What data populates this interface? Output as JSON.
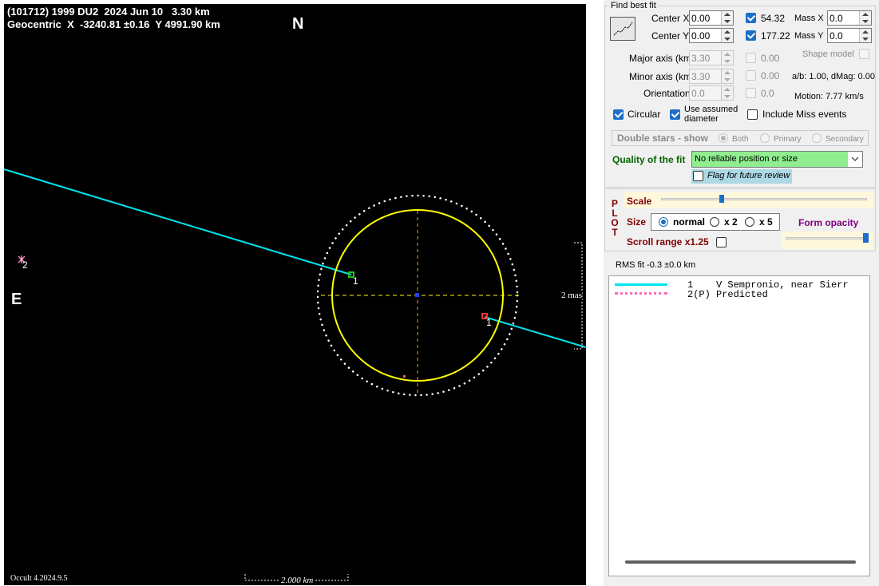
{
  "plot": {
    "title_line1": "(101712) 1999 DU2  2024 Jun 10   3.30 km",
    "title_line2": "Geocentric  X  -3240.81 ±0.16  Y 4991.90 km",
    "north_label": "N",
    "east_label": "E",
    "scale_mas_label": "2 mas",
    "scalebar_label": "2.000 km",
    "version_label": "Occult 4.2024.9.5",
    "chord_label_1a": "1",
    "chord_label_1b": "1",
    "star_label_2": "2",
    "colors": {
      "chord": "#00e5ee",
      "limb": "#ffff00",
      "axes": "#ffa020",
      "dotted_ring": "#ffffff",
      "dashed_h": "#ffff00",
      "reappear": "#ff3030",
      "disappear": "#20c020"
    }
  },
  "find_best_fit": {
    "legend": "Find best fit",
    "center_x_label": "Center X",
    "center_x_value": "0.00",
    "center_y_label": "Center Y",
    "center_y_value": "0.00",
    "center_x_result": "54.32",
    "center_y_result": "177.22",
    "mass_x_label": "Mass X",
    "mass_x_value": "0.0",
    "mass_y_label": "Mass Y",
    "mass_y_value": "0.0",
    "major_axis_label": "Major axis (km)",
    "major_axis_value": "3.30",
    "major_axis_result": "0.00",
    "minor_axis_label": "Minor axis (km)",
    "minor_axis_value": "3.30",
    "minor_axis_result": "0.00",
    "orientation_label": "Orientation",
    "orientation_value": "0.0",
    "orientation_result": "0.0",
    "shape_model_label": "Shape model",
    "ab_label": "a/b: 1.00, dMag: 0.00",
    "motion_label": "Motion: 7.77 km/s",
    "circular_label": "Circular",
    "use_assumed_diameter_label": "Use assumed diameter",
    "include_miss_label": "Include Miss events",
    "double_stars_label": "Double stars - show",
    "both_label": "Both",
    "primary_label": "Primary",
    "secondary_label": "Secondary",
    "quality_label": "Quality of the fit",
    "quality_value": "No reliable position or size",
    "flag_label": "Flag for future review"
  },
  "plot_panel": {
    "vertical_label": [
      "P",
      "L",
      "O",
      "T"
    ],
    "scale_label": "Scale",
    "size_label": "Size",
    "size_normal": "normal",
    "size_x2": "x 2",
    "size_x5": "x 5",
    "form_opacity_label": "Form opacity",
    "scroll_range_label": "Scroll range x1.25",
    "scale_level": 0.29,
    "opacity_level": 1.0
  },
  "rms_label": "RMS fit -0.3 ±0.0 km",
  "legend_list": [
    {
      "text": "1    V Sempronio, near Sierr",
      "style": "solid",
      "color": "#00e5ee"
    },
    {
      "text": "2(P) Predicted",
      "style": "dotted",
      "color": "#ff69b4"
    }
  ]
}
